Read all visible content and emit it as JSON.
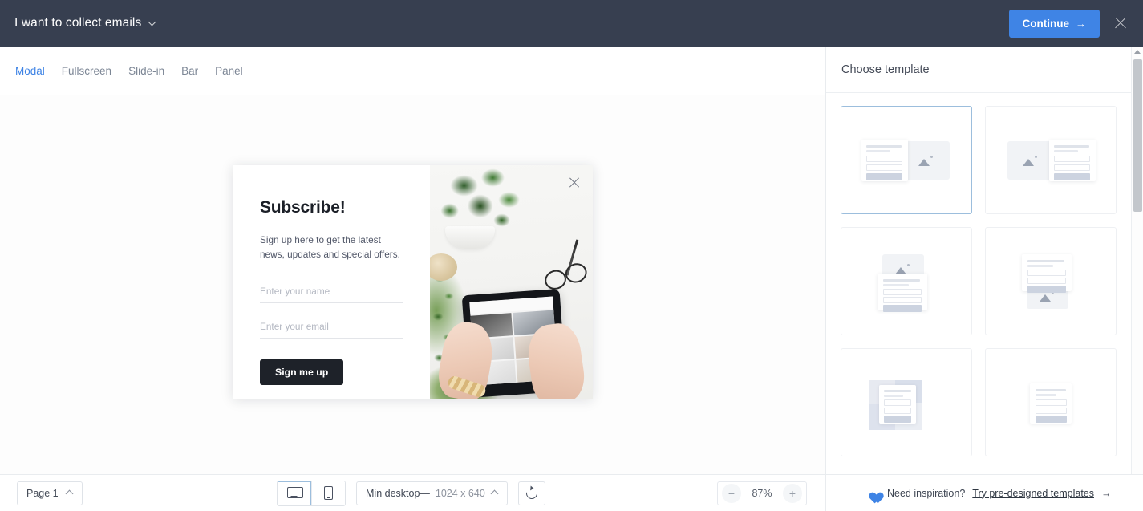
{
  "topbar": {
    "title": "I want to collect emails",
    "dropdown_icon": "chevron-down-icon",
    "continue_label": "Continue",
    "continue_arrow": "→",
    "close_icon": "close-icon",
    "bg_color": "#373f50",
    "accent_color": "#3f84e5"
  },
  "tabs": [
    {
      "label": "Modal",
      "active": true
    },
    {
      "label": "Fullscreen",
      "active": false
    },
    {
      "label": "Slide-in",
      "active": false
    },
    {
      "label": "Bar",
      "active": false
    },
    {
      "label": "Panel",
      "active": false
    }
  ],
  "modal_preview": {
    "heading": "Subscribe!",
    "subtext": "Sign up here to get the latest news, updates and special offers.",
    "name_placeholder": "Enter your name",
    "email_placeholder": "Enter your email",
    "cta_label": "Sign me up",
    "close_icon": "close-icon",
    "image_description": "plant on white desk with hands holding tablet"
  },
  "right_panel": {
    "title": "Choose template",
    "scrollbar_icon": "scroll-up-arrow-icon",
    "templates": [
      {
        "id": 1,
        "layout": "text-left-image-right",
        "selected": true
      },
      {
        "id": 2,
        "layout": "image-left-text-right",
        "selected": false
      },
      {
        "id": 3,
        "layout": "image-top-text-bottom",
        "selected": false
      },
      {
        "id": 4,
        "layout": "text-top-image-bottom",
        "selected": false
      },
      {
        "id": 5,
        "layout": "card-over-blocks",
        "selected": false
      },
      {
        "id": 6,
        "layout": "centered-card",
        "selected": false
      }
    ]
  },
  "footer": {
    "page_label": "Page 1",
    "page_chevron_icon": "chevron-up-icon",
    "device_desktop_icon": "desktop-icon",
    "device_mobile_icon": "mobile-icon",
    "device_active": "desktop",
    "dimension_label": "Min desktop—",
    "dimension_value": "1024 x 640",
    "dimension_chevron_icon": "chevron-up-icon",
    "refresh_icon": "refresh-icon",
    "zoom_out_label": "−",
    "zoom_level": "87%",
    "zoom_in_label": "+"
  },
  "inspiration": {
    "heart_icon": "heart-icon",
    "text": "Need inspiration?",
    "link": "Try pre-designed templates",
    "arrow": "→"
  }
}
